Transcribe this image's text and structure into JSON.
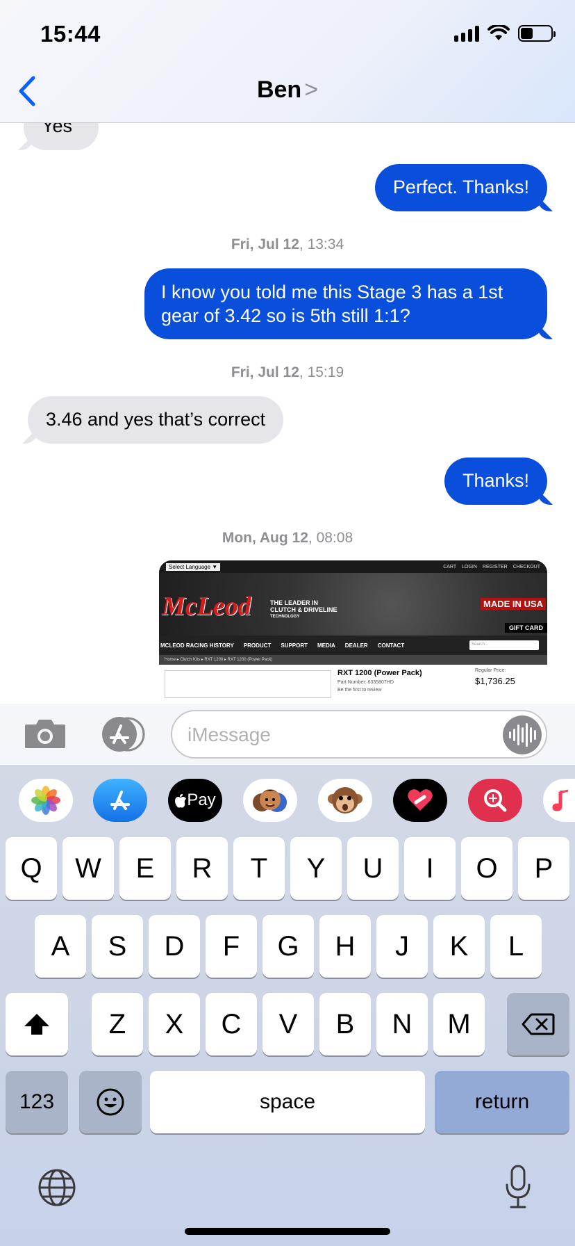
{
  "status": {
    "time": "15:44"
  },
  "header": {
    "contact_name": "Ben",
    "chevron": ">"
  },
  "messages": [
    {
      "from": "them",
      "text": "Yes"
    },
    {
      "from": "me",
      "text": "Perfect. Thanks!"
    },
    {
      "timestamp_day": "Fri, Jul 12",
      "timestamp_time": ", 13:34"
    },
    {
      "from": "me",
      "text": "I know you told me this Stage 3 has a 1st gear of 3.42 so is 5th still 1:1?"
    },
    {
      "timestamp_day": "Fri, Jul 12",
      "timestamp_time": ", 15:19"
    },
    {
      "from": "them",
      "text": "3.46 and yes that’s correct"
    },
    {
      "from": "me",
      "text": "Thanks!"
    },
    {
      "timestamp_day": "Mon, Aug 12",
      "timestamp_time": ", 08:08"
    }
  ],
  "attachment": {
    "lang_select": "Select Language ▼",
    "top_links": [
      "CART",
      "LOGIN",
      "REGISTER",
      "CHECKOUT"
    ],
    "logo": "McLeod",
    "tagline_1": "THE LEADER IN",
    "tagline_2": "CLUTCH & DRIVELINE",
    "tagline_3": "TECHNOLOGY",
    "made_in": "MADE IN USA",
    "gift": "GIFT CARD",
    "nav": [
      "MCLEOD RACING HISTORY",
      "PRODUCT",
      "SUPPORT",
      "MEDIA",
      "DEALER",
      "CONTACT"
    ],
    "search_placeholder": "Search...",
    "breadcrumb": "Home ▸ Clutch Kits ▸ RXT 1200 ▸ RXT 1200 (Power Pack)",
    "product_title": "RXT 1200 (Power Pack)",
    "part_number": "Part Number: 6335807HD",
    "review": "Be the first to review",
    "regular_price_label": "Regular Price:",
    "regular_price": "$1,736.25"
  },
  "input": {
    "placeholder": "iMessage"
  },
  "app_drawer": [
    "photos-app",
    "app-store-app",
    "apple-pay-app",
    "memoji-app",
    "animoji-app",
    "digital-touch-app",
    "image-search-app",
    "music-app"
  ],
  "apple_pay_label": "Pay",
  "keyboard": {
    "row1": [
      "Q",
      "W",
      "E",
      "R",
      "T",
      "Y",
      "U",
      "I",
      "O",
      "P"
    ],
    "row2": [
      "A",
      "S",
      "D",
      "F",
      "G",
      "H",
      "J",
      "K",
      "L"
    ],
    "row3": [
      "Z",
      "X",
      "C",
      "V",
      "B",
      "N",
      "M"
    ],
    "numbers": "123",
    "space": "space",
    "return": "return"
  }
}
